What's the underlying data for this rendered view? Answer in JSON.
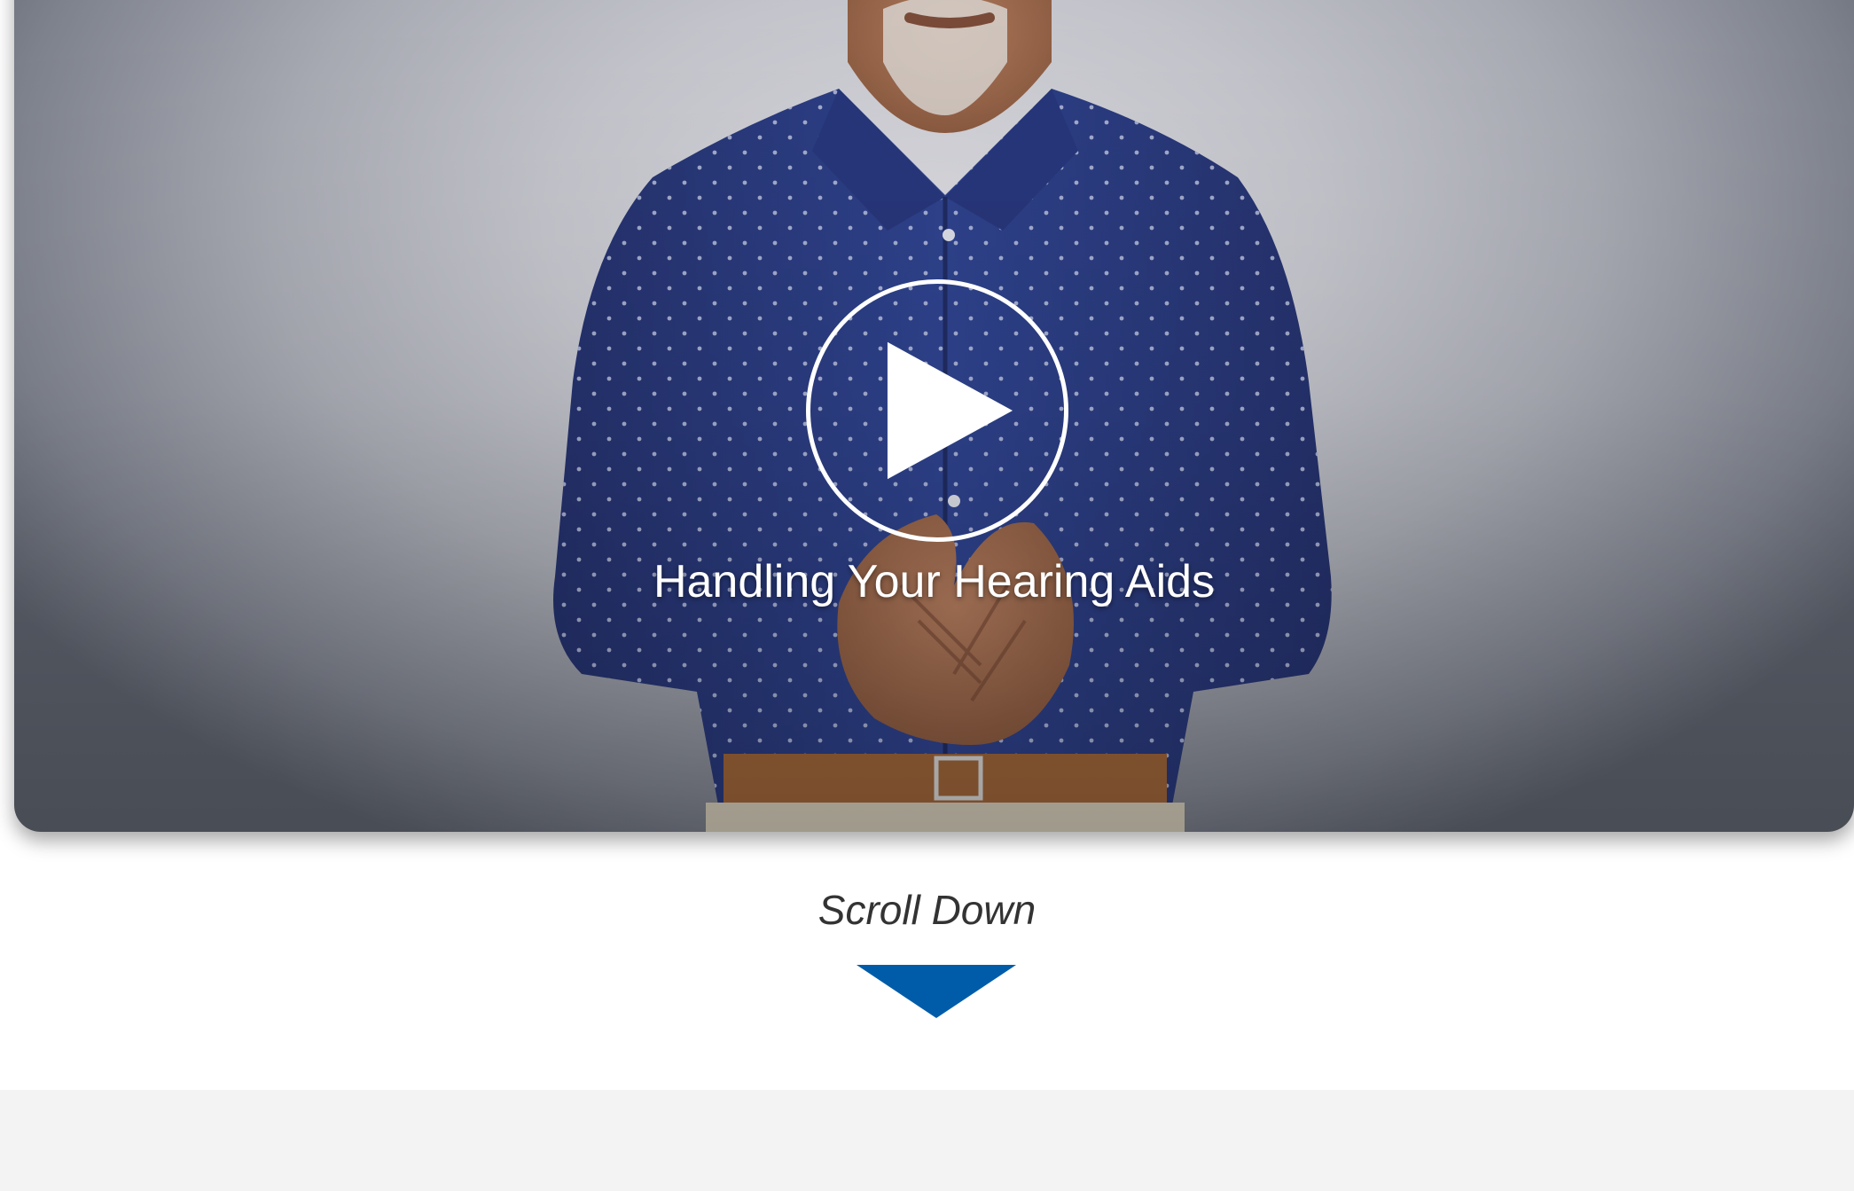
{
  "video": {
    "title": "Handling Your Hearing Aids",
    "play_icon": "play-icon"
  },
  "scroll_hint": {
    "label": "Scroll Down",
    "arrow_icon": "triangle-down-icon",
    "arrow_color": "#005ca9"
  },
  "colors": {
    "shirt": "#2b3d82",
    "background": "#c4c5cc",
    "footer_band": "#f3f3f3"
  }
}
